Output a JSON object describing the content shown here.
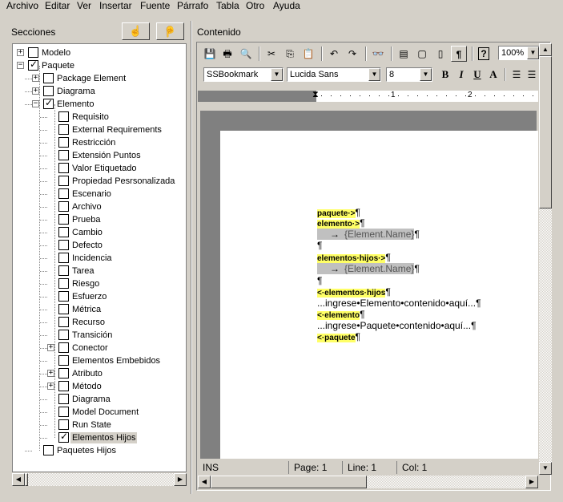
{
  "menu": [
    "Archivo",
    "Editar",
    "Ver",
    "Insertar",
    "Fuente",
    "Párrafo",
    "Tabla",
    "Otro",
    "Ayuda"
  ],
  "left_panel": {
    "title": "Secciones"
  },
  "right_panel": {
    "title": "Contenido"
  },
  "tree": [
    {
      "label": "Modelo",
      "level": 0,
      "expander": "+",
      "checked": false
    },
    {
      "label": "Paquete",
      "level": 0,
      "expander": "-",
      "checked": true
    },
    {
      "label": "Package Element",
      "level": 1,
      "expander": "+",
      "checked": false
    },
    {
      "label": "Diagrama",
      "level": 1,
      "expander": "+",
      "checked": false
    },
    {
      "label": "Elemento",
      "level": 1,
      "expander": "-",
      "checked": true
    },
    {
      "label": "Requisito",
      "level": 2,
      "expander": "",
      "checked": false
    },
    {
      "label": "External Requirements",
      "level": 2,
      "expander": "",
      "checked": false
    },
    {
      "label": "Restricción",
      "level": 2,
      "expander": "",
      "checked": false
    },
    {
      "label": "Extensión Puntos",
      "level": 2,
      "expander": "",
      "checked": false
    },
    {
      "label": "Valor Etiquetado",
      "level": 2,
      "expander": "",
      "checked": false
    },
    {
      "label": "Propiedad Pesrsonalizada",
      "level": 2,
      "expander": "",
      "checked": false
    },
    {
      "label": "Escenario",
      "level": 2,
      "expander": "",
      "checked": false
    },
    {
      "label": "Archivo",
      "level": 2,
      "expander": "",
      "checked": false
    },
    {
      "label": "Prueba",
      "level": 2,
      "expander": "",
      "checked": false
    },
    {
      "label": "Cambio",
      "level": 2,
      "expander": "",
      "checked": false
    },
    {
      "label": "Defecto",
      "level": 2,
      "expander": "",
      "checked": false
    },
    {
      "label": "Incidencia",
      "level": 2,
      "expander": "",
      "checked": false
    },
    {
      "label": "Tarea",
      "level": 2,
      "expander": "",
      "checked": false
    },
    {
      "label": "Riesgo",
      "level": 2,
      "expander": "",
      "checked": false
    },
    {
      "label": "Esfuerzo",
      "level": 2,
      "expander": "",
      "checked": false
    },
    {
      "label": "Métrica",
      "level": 2,
      "expander": "",
      "checked": false
    },
    {
      "label": "Recurso",
      "level": 2,
      "expander": "",
      "checked": false
    },
    {
      "label": "Transición",
      "level": 2,
      "expander": "",
      "checked": false
    },
    {
      "label": "Conector",
      "level": 2,
      "expander": "+",
      "checked": false
    },
    {
      "label": "Elementos Embebidos",
      "level": 2,
      "expander": "",
      "checked": false
    },
    {
      "label": "Atributo",
      "level": 2,
      "expander": "+",
      "checked": false
    },
    {
      "label": "Método",
      "level": 2,
      "expander": "+",
      "checked": false
    },
    {
      "label": "Diagrama",
      "level": 2,
      "expander": "",
      "checked": false
    },
    {
      "label": "Model Document",
      "level": 2,
      "expander": "",
      "checked": false
    },
    {
      "label": "Run State",
      "level": 2,
      "expander": "",
      "checked": false
    },
    {
      "label": "Elementos Hijos",
      "level": 2,
      "expander": "",
      "checked": true,
      "selected": true
    },
    {
      "label": "Paquetes Hijos",
      "level": 1,
      "expander": "",
      "checked": false
    }
  ],
  "format": {
    "style": "SSBookmark",
    "font": "Lucida Sans",
    "size": "8",
    "zoom": "100%"
  },
  "ruler": {
    "marks": [
      "1",
      "2"
    ]
  },
  "doc": {
    "paquete_open": "paquete·>",
    "elemento_open": "elemento·>",
    "arrow": "→",
    "element_name_field": "{Element.Name}",
    "pilcrow": "¶",
    "elementos_hijos_open": "elementos·hijos·>",
    "elementos_hijos_close": "<·elementos·hijos",
    "ingrese_elemento": "...ingrese•Elemento•contenido•aquí...",
    "elemento_close": "<·elemento",
    "ingrese_paquete": "...ingrese•Paquete•contenido•aquí...",
    "paquete_close": "<·paquete"
  },
  "status": {
    "mode": "INS",
    "page": "Page: 1",
    "line": "Line: 1",
    "col": "Col: 1"
  }
}
